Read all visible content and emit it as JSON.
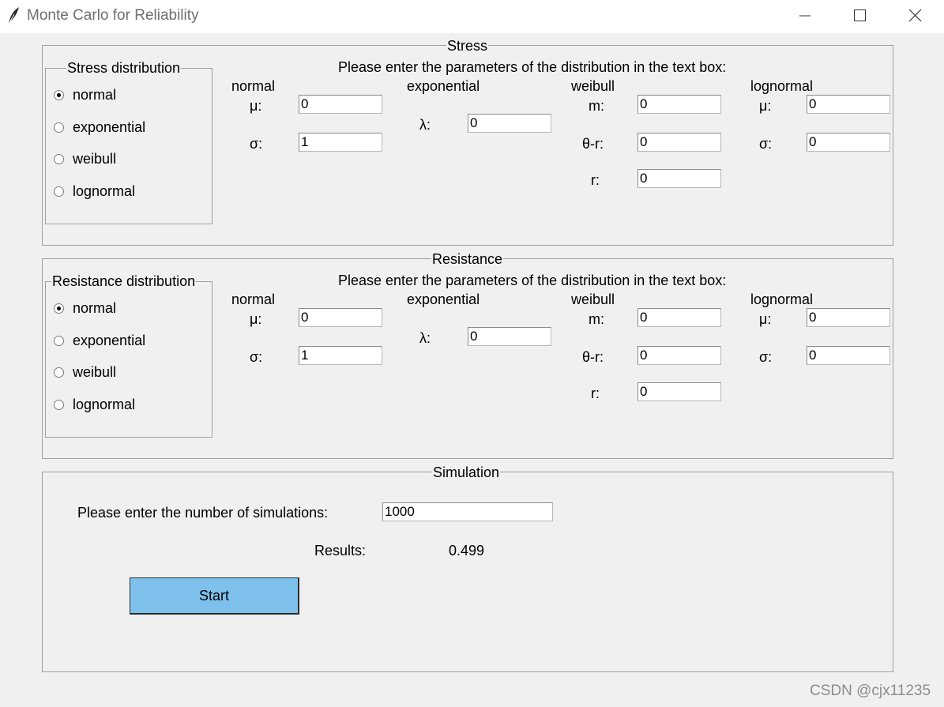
{
  "window": {
    "title": "Monte Carlo for Reliability",
    "icon": "feather-icon",
    "controls": {
      "minimize": "minimize-icon",
      "maximize": "maximize-icon",
      "close": "close-icon"
    }
  },
  "stress": {
    "frame_title": "Stress",
    "distribution_title": "Stress distribution",
    "options": [
      "normal",
      "exponential",
      "weibull",
      "lognormal"
    ],
    "selected": "normal",
    "instruction": "Please enter the parameters of the distribution in the text box:",
    "normal": {
      "heading": "normal",
      "mu_label": "μ:",
      "mu": "0",
      "sigma_label": "σ:",
      "sigma": "1"
    },
    "exponential": {
      "heading": "exponential",
      "lambda_label": "λ:",
      "lambda": "0"
    },
    "weibull": {
      "heading": "weibull",
      "m_label": "m:",
      "m": "0",
      "theta_label": "θ-r:",
      "theta": "0",
      "r_label": "r:",
      "r": "0"
    },
    "lognormal": {
      "heading": "lognormal",
      "mu_label": "μ:",
      "mu": "0",
      "sigma_label": "σ:",
      "sigma": "0"
    }
  },
  "resistance": {
    "frame_title": "Resistance",
    "distribution_title": "Resistance distribution",
    "options": [
      "normal",
      "exponential",
      "weibull",
      "lognormal"
    ],
    "selected": "normal",
    "instruction": "Please enter the parameters of the distribution in the text box:",
    "normal": {
      "heading": "normal",
      "mu_label": "μ:",
      "mu": "0",
      "sigma_label": "σ:",
      "sigma": "1"
    },
    "exponential": {
      "heading": "exponential",
      "lambda_label": "λ:",
      "lambda": "0"
    },
    "weibull": {
      "heading": "weibull",
      "m_label": "m:",
      "m": "0",
      "theta_label": "θ-r:",
      "theta": "0",
      "r_label": "r:",
      "r": "0"
    },
    "lognormal": {
      "heading": "lognormal",
      "mu_label": "μ:",
      "mu": "0",
      "sigma_label": "σ:",
      "sigma": "0"
    }
  },
  "simulation": {
    "frame_title": "Simulation",
    "count_label": "Please enter the number of simulations:",
    "count": "1000",
    "results_label": "Results:",
    "results_value": "0.499",
    "start_label": "Start"
  },
  "watermark": "CSDN @cjx11235",
  "colors": {
    "button": "#7dc1ec",
    "background": "#f0f0f0"
  }
}
